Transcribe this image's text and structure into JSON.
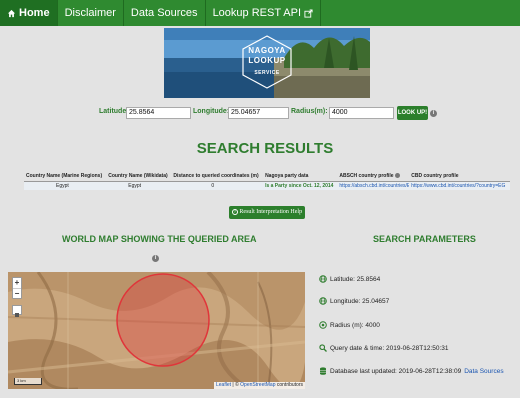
{
  "nav": {
    "home": "Home",
    "disclaimer": "Disclaimer",
    "data_sources": "Data Sources",
    "lookup_api": "Lookup REST API"
  },
  "hero": {
    "line1": "NAGOYA",
    "line2": "LOOKUP",
    "line3": "SERVICE"
  },
  "form": {
    "latitude_label": "Latitude:",
    "latitude_value": "25.8564",
    "longitude_label": "Longitude:",
    "longitude_value": "25.04657",
    "radius_label": "Radius(m):",
    "radius_value": "4000",
    "submit_label": "LOOK UP!",
    "info_icon": "info-icon"
  },
  "results": {
    "heading": "SEARCH RESULTS",
    "columns": [
      "Country Name (Marine Regions)",
      "Country Name (Wikidata)",
      "Distance to queried coordinates (m)",
      "Nagoya party data",
      "ABSCH country profile",
      "CBD country profile"
    ],
    "rows": [
      {
        "marine": "Egypt",
        "wikidata": "Egypt",
        "distance": "0",
        "party": "Is a Party since Oct. 12, 2014",
        "absch": "https://absch.cbd.int/countries/EG",
        "cbd": "https://www.cbd.int/countries/?country=EG"
      }
    ],
    "help_button": "Result Interpretation Help"
  },
  "map": {
    "heading": "WORLD MAP SHOWING THE QUERIED AREA",
    "zoom_in": "+",
    "zoom_out": "−",
    "scale": "3 km",
    "attribution_leaflet": "Leaflet",
    "attribution_sep": " | © ",
    "attribution_osm": "OpenStreetMap",
    "attribution_tail": " contributors",
    "circle_color": "#e0353a"
  },
  "params": {
    "heading": "SEARCH PARAMETERS",
    "latitude": "Latitude: 25.8564",
    "longitude": "Longitude: 25.04657",
    "radius": "Radius (m): 4000",
    "query_date": "Query date & time: 2019-06-28T12:50:31",
    "db_updated": "Database last updated: 2019-06-28T12:38:09",
    "db_link": "Data Sources"
  },
  "colors": {
    "accent": "#2f8a30",
    "heading_green": "#2f7d2f",
    "link": "#1a55b0"
  }
}
